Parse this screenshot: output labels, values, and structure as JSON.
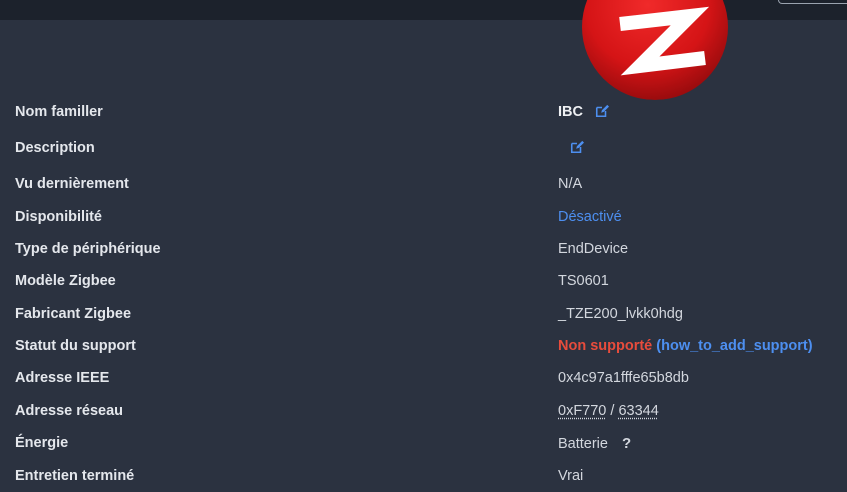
{
  "colors": {
    "background": "#2b3240",
    "topbar": "#1c222c",
    "label": "#e4e7ec",
    "value": "#d3d7de",
    "link": "#4d8ff0",
    "danger": "#e74c3c",
    "logo_red": "#d51416"
  },
  "device": {
    "rows": [
      {
        "label": "Nom familler",
        "value": "IBC"
      },
      {
        "label": "Description",
        "value": ""
      },
      {
        "label": "Vu dernièrement",
        "value": "N/A"
      },
      {
        "label": "Disponibilité",
        "value": "Désactivé"
      },
      {
        "label": "Type de périphérique",
        "value": "EndDevice"
      },
      {
        "label": "Modèle Zigbee",
        "value": "TS0601"
      },
      {
        "label": "Fabricant Zigbee",
        "value": "_TZE200_lvkk0hdg"
      },
      {
        "label": "Statut du support",
        "value": "Non supporté",
        "link": "(how_to_add_support)"
      },
      {
        "label": "Adresse IEEE",
        "value": "0x4c97a1fffe65b8db"
      },
      {
        "label": "Adresse réseau",
        "value": "0xF770",
        "separator": " / ",
        "value_alt": "63344"
      },
      {
        "label": "Énergie",
        "value": "Batterie",
        "help": "?"
      },
      {
        "label": "Entretien terminé",
        "value": "Vrai"
      }
    ]
  },
  "icons": {
    "edit": "edit-icon",
    "help": "question-mark-icon",
    "logo": "zigbee-logo-icon"
  }
}
